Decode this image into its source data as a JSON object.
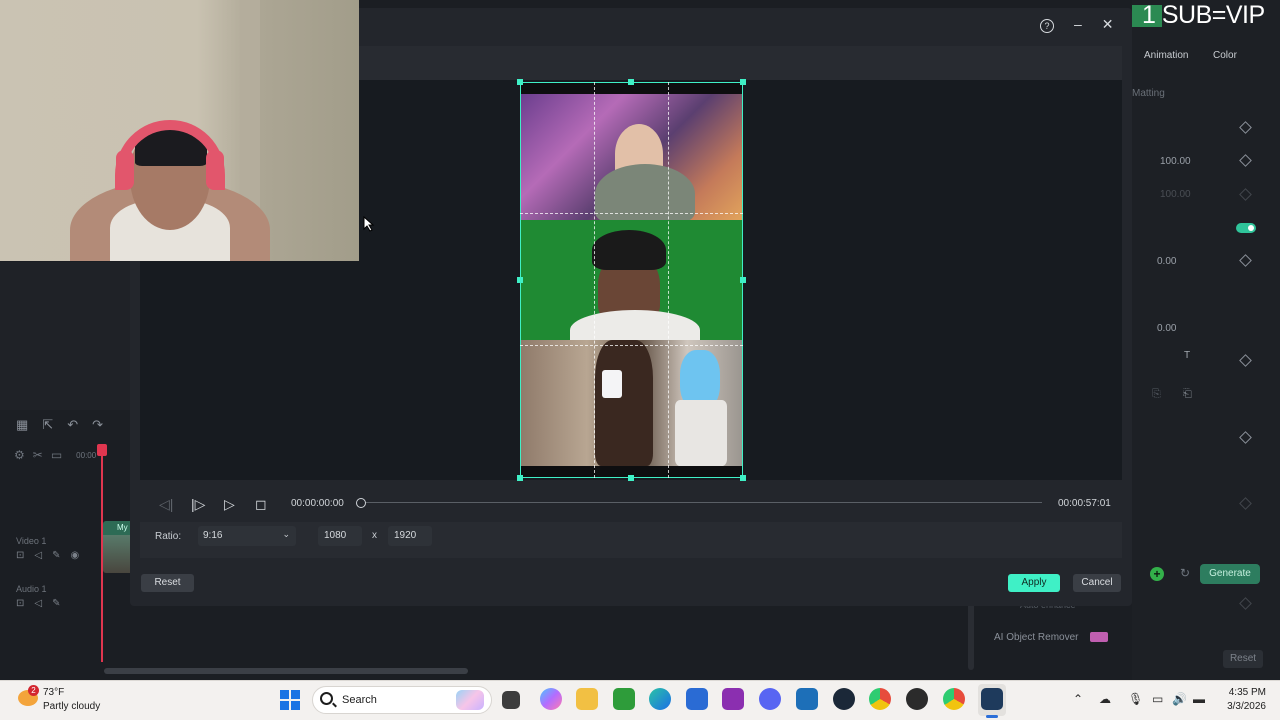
{
  "overlay": {
    "sub_text": "1 SUB=VIP"
  },
  "right_panel": {
    "tabs": [
      "Animation",
      "Color"
    ],
    "matting_label": "Matting",
    "values": [
      "100.00",
      "100.00",
      "0.00",
      "0.00"
    ],
    "generate_label": "Generate",
    "auto_enhance_label": "Auto enhance",
    "ai_object_remover_label": "AI Object Remover",
    "reset_label": "Reset"
  },
  "timeline": {
    "ruler_label": "00:00",
    "video_track_label": "Video 1",
    "audio_track_label": "Audio 1",
    "clip_label": "My"
  },
  "crop_dialog": {
    "playback": {
      "current_time": "00:00:00:00",
      "total_time": "00:00:57:01",
      "progress": 0
    },
    "ratio_label": "Ratio:",
    "ratio_value": "9:16",
    "width": "1080",
    "height": "1920",
    "times_symbol": "x",
    "reset_label": "Reset",
    "apply_label": "Apply",
    "cancel_label": "Cancel",
    "accent_color": "#3ff0c6"
  },
  "taskbar": {
    "weather_badge": "2",
    "temperature": "73°F",
    "condition": "Partly cloudy",
    "search_placeholder": "Search",
    "time": "4:35 PM",
    "date": "3/3/2026"
  }
}
